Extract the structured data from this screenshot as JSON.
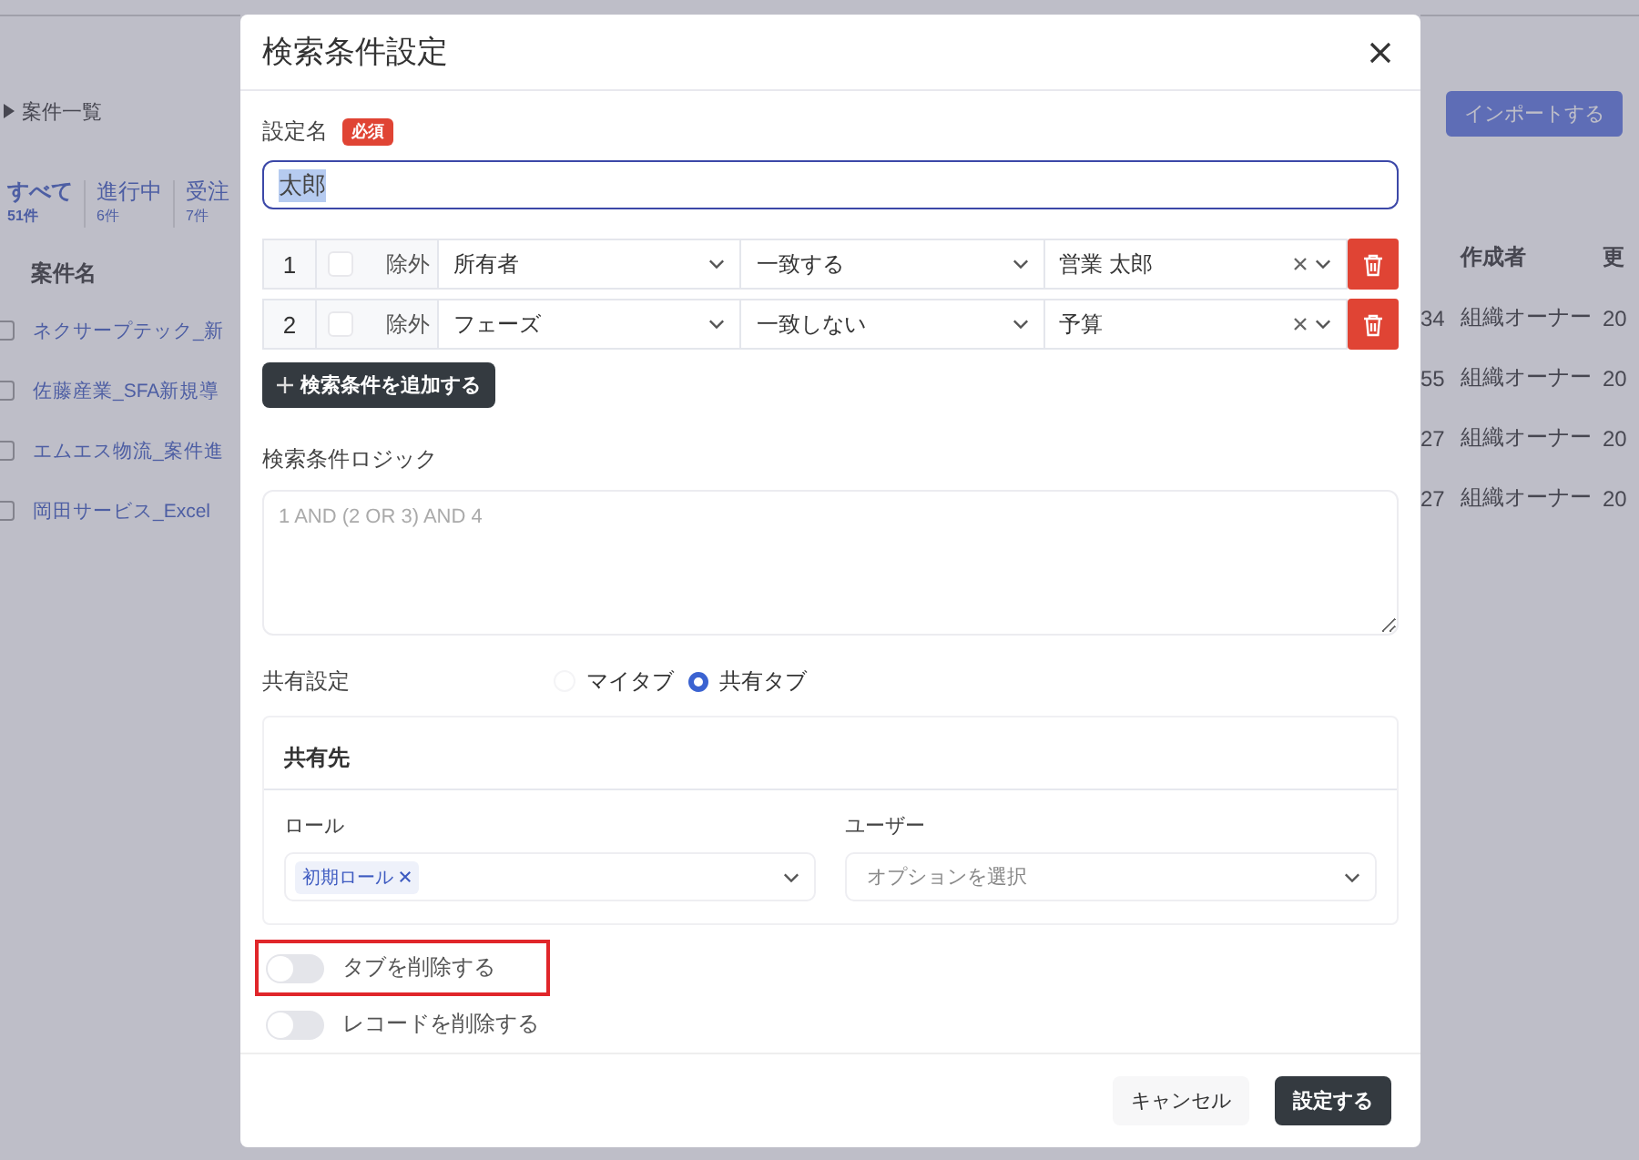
{
  "background": {
    "breadcrumb": "案件一覧",
    "import_button": "インポートする",
    "tabs": [
      {
        "label": "すべて",
        "count": "51件",
        "selected": true
      },
      {
        "label": "進行中",
        "count": "6件",
        "selected": false
      },
      {
        "label": "受注",
        "count": "7件",
        "selected": false
      }
    ],
    "columns": [
      "案件名",
      "作成者",
      "更"
    ],
    "rows": [
      {
        "checked": false,
        "name": "ネクサープテック_新",
        "column_2": "34",
        "creator": "組織オーナー",
        "updated": "20"
      },
      {
        "checked": false,
        "name": "佐藤産業_SFA新規導",
        "column_2": "55",
        "creator": "組織オーナー",
        "updated": "20"
      },
      {
        "checked": false,
        "name": "エムエス物流_案件進",
        "column_2": "27",
        "creator": "組織オーナー",
        "updated": "20"
      },
      {
        "checked": false,
        "name": "岡田サービス_Excel",
        "column_2": "27",
        "creator": "組織オーナー",
        "updated": "20"
      }
    ]
  },
  "dialog": {
    "title": "検索条件設定",
    "name_label": "設定名",
    "required_badge": "必須",
    "name_value": "太郎",
    "conditions": [
      {
        "number": "1",
        "exclude_label": "除外",
        "excluded": false,
        "field": "所有者",
        "operator": "一致する",
        "value": "営業 太郎"
      },
      {
        "number": "2",
        "exclude_label": "除外",
        "excluded": false,
        "field": "フェーズ",
        "operator": "一致しない",
        "value": "予算"
      }
    ],
    "add_button": "検索条件を追加する",
    "logic_label": "検索条件ロジック",
    "logic_placeholder": "1 AND (2 OR 3) AND 4",
    "sharing_label": "共有設定",
    "sharing_options": [
      {
        "label": "マイタブ",
        "selected": false
      },
      {
        "label": "共有タブ",
        "selected": true
      }
    ],
    "share_target": {
      "title": "共有先",
      "role_label": "ロール",
      "roles": [
        "初期ロール"
      ],
      "user_label": "ユーザー",
      "user_placeholder": "オプションを選択"
    },
    "toggles": [
      {
        "label": "タブを削除する",
        "on": false,
        "highlighted": true
      },
      {
        "label": "レコードを削除する",
        "on": false,
        "highlighted": false
      }
    ],
    "buttons": [
      {
        "label": "キャンセル",
        "kind": "secondary"
      },
      {
        "label": "設定する",
        "kind": "primary"
      }
    ]
  }
}
